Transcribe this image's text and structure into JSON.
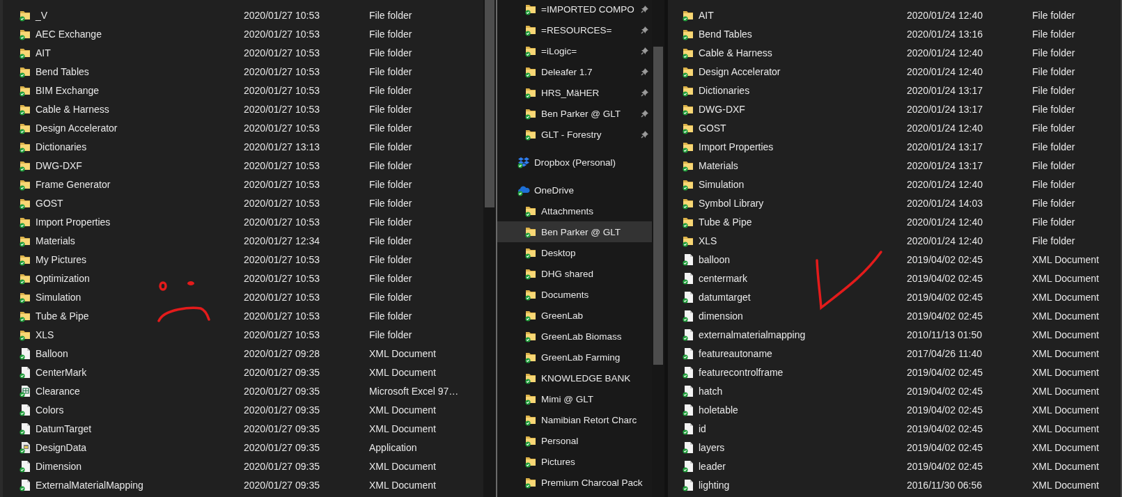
{
  "left_pane": {
    "rows": [
      {
        "name": "_V",
        "date_modified": "2020/01/27 10:53",
        "type": "File folder",
        "kind": "folder"
      },
      {
        "name": "AEC Exchange",
        "date_modified": "2020/01/27 10:53",
        "type": "File folder",
        "kind": "folder"
      },
      {
        "name": "AIT",
        "date_modified": "2020/01/27 10:53",
        "type": "File folder",
        "kind": "folder"
      },
      {
        "name": "Bend Tables",
        "date_modified": "2020/01/27 10:53",
        "type": "File folder",
        "kind": "folder"
      },
      {
        "name": "BIM Exchange",
        "date_modified": "2020/01/27 10:53",
        "type": "File folder",
        "kind": "folder"
      },
      {
        "name": "Cable & Harness",
        "date_modified": "2020/01/27 10:53",
        "type": "File folder",
        "kind": "folder"
      },
      {
        "name": "Design Accelerator",
        "date_modified": "2020/01/27 10:53",
        "type": "File folder",
        "kind": "folder"
      },
      {
        "name": "Dictionaries",
        "date_modified": "2020/01/27 13:13",
        "type": "File folder",
        "kind": "folder"
      },
      {
        "name": "DWG-DXF",
        "date_modified": "2020/01/27 10:53",
        "type": "File folder",
        "kind": "folder"
      },
      {
        "name": "Frame Generator",
        "date_modified": "2020/01/27 10:53",
        "type": "File folder",
        "kind": "folder"
      },
      {
        "name": "GOST",
        "date_modified": "2020/01/27 10:53",
        "type": "File folder",
        "kind": "folder"
      },
      {
        "name": "Import Properties",
        "date_modified": "2020/01/27 10:53",
        "type": "File folder",
        "kind": "folder"
      },
      {
        "name": "Materials",
        "date_modified": "2020/01/27 12:34",
        "type": "File folder",
        "kind": "folder"
      },
      {
        "name": "My Pictures",
        "date_modified": "2020/01/27 10:53",
        "type": "File folder",
        "kind": "folder"
      },
      {
        "name": "Optimization",
        "date_modified": "2020/01/27 10:53",
        "type": "File folder",
        "kind": "folder"
      },
      {
        "name": "Simulation",
        "date_modified": "2020/01/27 10:53",
        "type": "File folder",
        "kind": "folder"
      },
      {
        "name": "Tube & Pipe",
        "date_modified": "2020/01/27 10:53",
        "type": "File folder",
        "kind": "folder"
      },
      {
        "name": "XLS",
        "date_modified": "2020/01/27 10:53",
        "type": "File folder",
        "kind": "folder"
      },
      {
        "name": "Balloon",
        "date_modified": "2020/01/27 09:28",
        "type": "XML Document",
        "kind": "document"
      },
      {
        "name": "CenterMark",
        "date_modified": "2020/01/27 09:35",
        "type": "XML Document",
        "kind": "document"
      },
      {
        "name": "Clearance",
        "date_modified": "2020/01/27 09:35",
        "type": "Microsoft Excel 97…",
        "kind": "spreadsheet"
      },
      {
        "name": "Colors",
        "date_modified": "2020/01/27 09:35",
        "type": "XML Document",
        "kind": "document"
      },
      {
        "name": "DatumTarget",
        "date_modified": "2020/01/27 09:35",
        "type": "XML Document",
        "kind": "document"
      },
      {
        "name": "DesignData",
        "date_modified": "2020/01/27 09:35",
        "type": "Application",
        "kind": "application"
      },
      {
        "name": "Dimension",
        "date_modified": "2020/01/27 09:35",
        "type": "XML Document",
        "kind": "document"
      },
      {
        "name": "ExternalMaterialMapping",
        "date_modified": "2020/01/27 09:35",
        "type": "XML Document",
        "kind": "document"
      }
    ]
  },
  "navigation_pane": {
    "items": [
      {
        "label": "=IMPORTED COMPO",
        "kind": "folder",
        "pinned": true,
        "selected": false
      },
      {
        "label": "=RESOURCES=",
        "kind": "folder",
        "pinned": true,
        "selected": false
      },
      {
        "label": "=iLogic=",
        "kind": "folder",
        "pinned": true,
        "selected": false
      },
      {
        "label": "Deleafer 1.7",
        "kind": "folder",
        "pinned": true,
        "selected": false
      },
      {
        "label": "HRS_MäHER",
        "kind": "folder",
        "pinned": true,
        "selected": false
      },
      {
        "label": "Ben Parker @ GLT",
        "kind": "folder",
        "pinned": true,
        "selected": false
      },
      {
        "label": "GLT - Forestry",
        "kind": "folder",
        "pinned": true,
        "selected": false
      },
      {
        "label": "Dropbox (Personal)",
        "kind": "dropbox",
        "pinned": false,
        "selected": false
      },
      {
        "label": "OneDrive",
        "kind": "onedrive",
        "pinned": false,
        "selected": false
      },
      {
        "label": "Attachments",
        "kind": "folder",
        "pinned": false,
        "selected": false
      },
      {
        "label": "Ben Parker @ GLT",
        "kind": "folder",
        "pinned": false,
        "selected": true
      },
      {
        "label": "Desktop",
        "kind": "folder",
        "pinned": false,
        "selected": false
      },
      {
        "label": "DHG shared",
        "kind": "folder",
        "pinned": false,
        "selected": false
      },
      {
        "label": "Documents",
        "kind": "folder",
        "pinned": false,
        "selected": false
      },
      {
        "label": "GreenLab",
        "kind": "folder",
        "pinned": false,
        "selected": false
      },
      {
        "label": "GreenLab Biomass",
        "kind": "folder",
        "pinned": false,
        "selected": false
      },
      {
        "label": "GreenLab Farming",
        "kind": "folder",
        "pinned": false,
        "selected": false
      },
      {
        "label": "KNOWLEDGE BANK",
        "kind": "folder",
        "pinned": false,
        "selected": false
      },
      {
        "label": "Mimi @ GLT",
        "kind": "folder",
        "pinned": false,
        "selected": false
      },
      {
        "label": "Namibian Retort Charc",
        "kind": "folder",
        "pinned": false,
        "selected": false
      },
      {
        "label": "Personal",
        "kind": "folder",
        "pinned": false,
        "selected": false
      },
      {
        "label": "Pictures",
        "kind": "folder",
        "pinned": false,
        "selected": false
      },
      {
        "label": "Premium Charcoal Pack",
        "kind": "folder",
        "pinned": false,
        "selected": false
      }
    ]
  },
  "right_pane": {
    "rows": [
      {
        "name": "AIT",
        "date_modified": "2020/01/24 12:40",
        "type": "File folder",
        "kind": "folder"
      },
      {
        "name": "Bend Tables",
        "date_modified": "2020/01/24 13:16",
        "type": "File folder",
        "kind": "folder"
      },
      {
        "name": "Cable & Harness",
        "date_modified": "2020/01/24 12:40",
        "type": "File folder",
        "kind": "folder"
      },
      {
        "name": "Design Accelerator",
        "date_modified": "2020/01/24 12:40",
        "type": "File folder",
        "kind": "folder"
      },
      {
        "name": "Dictionaries",
        "date_modified": "2020/01/24 13:17",
        "type": "File folder",
        "kind": "folder"
      },
      {
        "name": "DWG-DXF",
        "date_modified": "2020/01/24 13:17",
        "type": "File folder",
        "kind": "folder"
      },
      {
        "name": "GOST",
        "date_modified": "2020/01/24 12:40",
        "type": "File folder",
        "kind": "folder"
      },
      {
        "name": "Import Properties",
        "date_modified": "2020/01/24 13:17",
        "type": "File folder",
        "kind": "folder"
      },
      {
        "name": "Materials",
        "date_modified": "2020/01/24 13:17",
        "type": "File folder",
        "kind": "folder"
      },
      {
        "name": "Simulation",
        "date_modified": "2020/01/24 12:40",
        "type": "File folder",
        "kind": "folder"
      },
      {
        "name": "Symbol Library",
        "date_modified": "2020/01/24 14:03",
        "type": "File folder",
        "kind": "folder"
      },
      {
        "name": "Tube & Pipe",
        "date_modified": "2020/01/24 12:40",
        "type": "File folder",
        "kind": "folder"
      },
      {
        "name": "XLS",
        "date_modified": "2020/01/24 12:40",
        "type": "File folder",
        "kind": "folder"
      },
      {
        "name": "balloon",
        "date_modified": "2019/04/02 02:45",
        "type": "XML Document",
        "kind": "document"
      },
      {
        "name": "centermark",
        "date_modified": "2019/04/02 02:45",
        "type": "XML Document",
        "kind": "document"
      },
      {
        "name": "datumtarget",
        "date_modified": "2019/04/02 02:45",
        "type": "XML Document",
        "kind": "document"
      },
      {
        "name": "dimension",
        "date_modified": "2019/04/02 02:45",
        "type": "XML Document",
        "kind": "document"
      },
      {
        "name": "externalmaterialmapping",
        "date_modified": "2010/11/13 01:50",
        "type": "XML Document",
        "kind": "document"
      },
      {
        "name": "featureautoname",
        "date_modified": "2017/04/26 11:40",
        "type": "XML Document",
        "kind": "document"
      },
      {
        "name": "featurecontrolframe",
        "date_modified": "2019/04/02 02:45",
        "type": "XML Document",
        "kind": "document"
      },
      {
        "name": "hatch",
        "date_modified": "2019/04/02 02:45",
        "type": "XML Document",
        "kind": "document"
      },
      {
        "name": "holetable",
        "date_modified": "2019/04/02 02:45",
        "type": "XML Document",
        "kind": "document"
      },
      {
        "name": "id",
        "date_modified": "2019/04/02 02:45",
        "type": "XML Document",
        "kind": "document"
      },
      {
        "name": "layers",
        "date_modified": "2019/04/02 02:45",
        "type": "XML Document",
        "kind": "document"
      },
      {
        "name": "leader",
        "date_modified": "2019/04/02 02:45",
        "type": "XML Document",
        "kind": "document"
      },
      {
        "name": "lighting",
        "date_modified": "2016/11/30 06:56",
        "type": "XML Document",
        "kind": "document"
      }
    ]
  }
}
